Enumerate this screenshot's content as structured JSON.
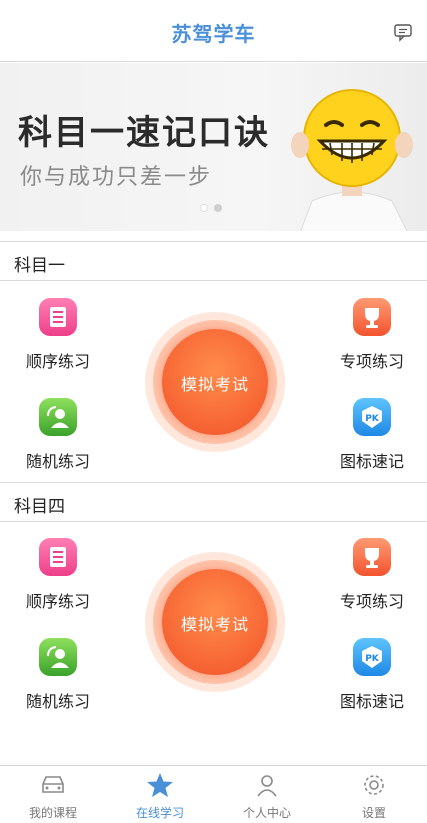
{
  "header": {
    "title": "苏驾学车",
    "message_icon": "message-icon"
  },
  "banner": {
    "headline": "科目一速记口诀",
    "subtitle": "你与成功只差一步",
    "slide_count": 2,
    "active_slide": 1
  },
  "sections": [
    {
      "title": "科目一",
      "items": {
        "order": "顺序练习",
        "special": "专项练习",
        "random": "随机练习",
        "icons": "图标速记"
      },
      "exam_label": "模拟考试"
    },
    {
      "title": "科目四",
      "items": {
        "order": "顺序练习",
        "special": "专项练习",
        "random": "随机练习",
        "icons": "图标速记"
      },
      "exam_label": "模拟考试"
    }
  ],
  "tabs": [
    {
      "label": "我的课程",
      "icon": "car-icon"
    },
    {
      "label": "在线学习",
      "icon": "star-icon",
      "active": true
    },
    {
      "label": "个人中心",
      "icon": "user-icon"
    },
    {
      "label": "设置",
      "icon": "gear-icon"
    }
  ],
  "colors": {
    "accent": "#4a90d9",
    "exam": "#f2542f"
  }
}
